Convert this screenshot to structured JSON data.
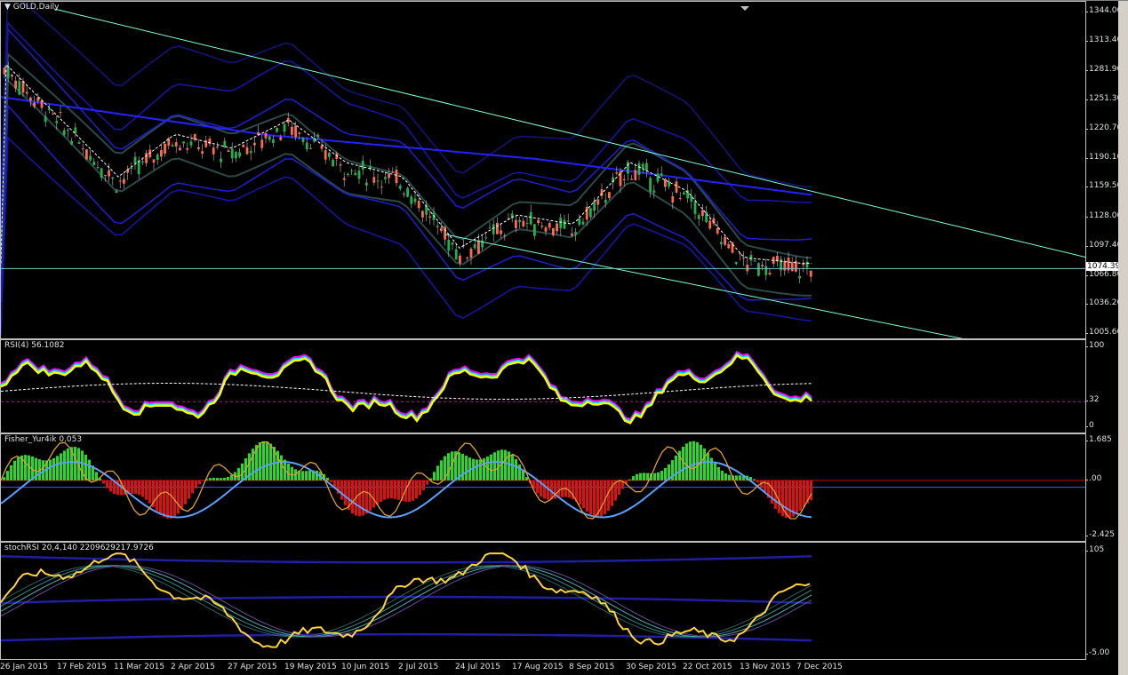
{
  "symbol": {
    "title": "GOLD,Daily",
    "marker": "▼"
  },
  "current_price": "1074.39",
  "price_scale": [
    "1344.00",
    "1313.40",
    "1281.90",
    "1251.30",
    "1220.70",
    "1190.10",
    "1159.50",
    "1128.00",
    "1097.40",
    "1066.80",
    "1036.20",
    "1005.60"
  ],
  "rsi": {
    "title": "RSI(4) 56.1082",
    "scale": [
      "100",
      "32",
      "0"
    ]
  },
  "fisher": {
    "title": "Fisher_Yur4ik 0.053",
    "scale": [
      "1.685",
      ".00",
      "-2.425"
    ]
  },
  "stochrsi": {
    "title": "stochRSI 20,4,140 2209629217.9726",
    "scale": [
      "105",
      "-5.00"
    ]
  },
  "dates": [
    "26 Jan 2015",
    "17 Feb 2015",
    "11 Mar 2015",
    "2 Apr 2015",
    "27 Apr 2015",
    "19 May 2015",
    "10 Jun 2015",
    "2 Jul 2015",
    "24 Jul 2015",
    "17 Aug 2015",
    "8 Sep 2015",
    "30 Sep 2015",
    "22 Oct 2015",
    "13 Nov 2015",
    "7 Dec 2015"
  ],
  "chart_data": {
    "type": "line",
    "title": "GOLD,Daily",
    "ylim": [
      1005.6,
      1344.0
    ],
    "x": [
      "26 Jan 2015",
      "17 Feb 2015",
      "11 Mar 2015",
      "2 Apr 2015",
      "27 Apr 2015",
      "19 May 2015",
      "10 Jun 2015",
      "2 Jul 2015",
      "24 Jul 2015",
      "17 Aug 2015",
      "8 Sep 2015",
      "30 Sep 2015",
      "22 Oct 2015",
      "13 Nov 2015",
      "7 Dec 2015"
    ],
    "series": [
      {
        "values": [
          1285,
          1225,
          1165,
          1210,
          1195,
          1225,
          1180,
          1165,
          1090,
          1125,
          1115,
          1180,
          1150,
          1080,
          1074
        ]
      }
    ],
    "colors": {
      "up": "#21b24b",
      "down": "#ff6a4d",
      "trend": "#7fffd4",
      "band": "#1f1fcf"
    }
  }
}
